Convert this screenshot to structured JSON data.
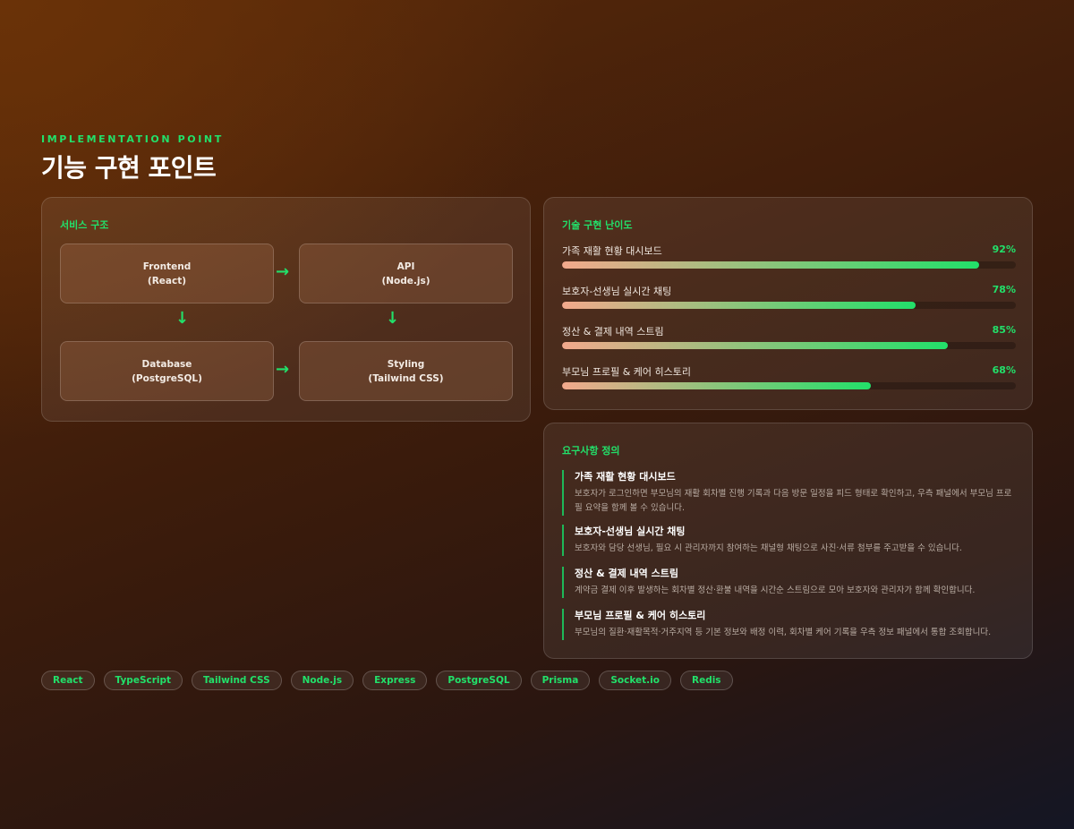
{
  "header": {
    "eyebrow": "IMPLEMENTATION POINT",
    "title": "기능 구현 포인트"
  },
  "architecture": {
    "title": "서비스 구조",
    "nodes": [
      {
        "name": "Frontend",
        "tech": "(React)"
      },
      {
        "name": "API",
        "tech": "(Node.js)"
      },
      {
        "name": "Database",
        "tech": "(PostgreSQL)"
      },
      {
        "name": "Styling",
        "tech": "(Tailwind CSS)"
      }
    ],
    "arrows": {
      "right": "→",
      "down": "↓"
    }
  },
  "difficulty": {
    "title": "기술 구현 난이도",
    "items": [
      {
        "label": "가족 재활 현황 대시보드",
        "percent_text": "92%",
        "value": 92
      },
      {
        "label": "보호자-선생님 실시간 채팅",
        "percent_text": "78%",
        "value": 78
      },
      {
        "label": "정산 & 결제 내역 스트림",
        "percent_text": "85%",
        "value": 85
      },
      {
        "label": "부모님 프로필 & 케어 히스토리",
        "percent_text": "68%",
        "value": 68
      }
    ]
  },
  "requirements": {
    "title": "요구사항 정의",
    "items": [
      {
        "title": "가족 재활 현황 대시보드",
        "desc": "보호자가 로그인하면 부모님의 재활 회차별 진행 기록과 다음 방문 일정을 피드 형태로 확인하고, 우측 패널에서 부모님 프로필 요약을 함께 볼 수 있습니다."
      },
      {
        "title": "보호자-선생님 실시간 채팅",
        "desc": "보호자와 담당 선생님, 필요 시 관리자까지 참여하는 채널형 채팅으로 사진·서류 첨부를 주고받을 수 있습니다."
      },
      {
        "title": "정산 & 결제 내역 스트림",
        "desc": "계약금 결제 이후 발생하는 회차별 정산·환불 내역을 시간순 스트림으로 모아 보호자와 관리자가 함께 확인합니다."
      },
      {
        "title": "부모님 프로필 & 케어 히스토리",
        "desc": "부모님의 질환·재활목적·거주지역 등 기본 정보와 배정 이력, 회차별 케어 기록을 우측 정보 패널에서 통합 조회합니다."
      }
    ]
  },
  "tags": [
    "React",
    "TypeScript",
    "Tailwind CSS",
    "Node.js",
    "Express",
    "PostgreSQL",
    "Prisma",
    "Socket.io",
    "Redis"
  ],
  "colors": {
    "accent": "#22e06a",
    "bar_start": "#f3a98c",
    "bar_end": "#22e06a"
  }
}
